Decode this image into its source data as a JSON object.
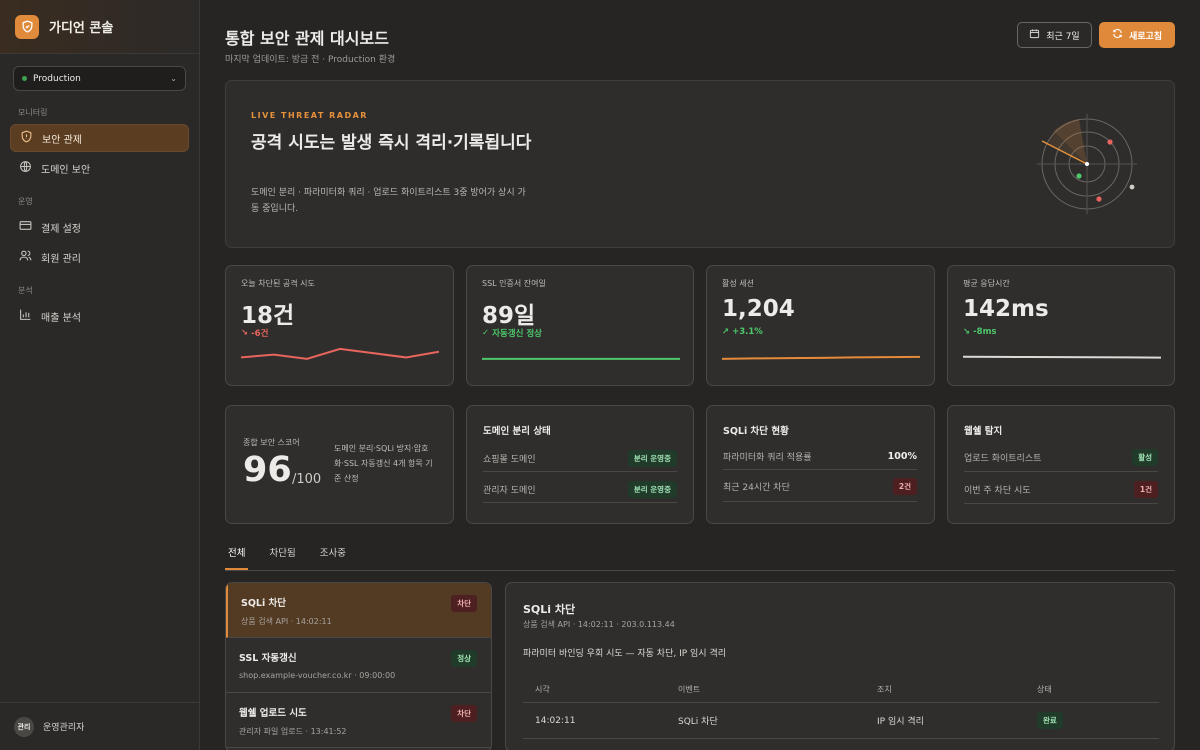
{
  "brand": {
    "name": "가디언 콘솔"
  },
  "env": {
    "label": "Production"
  },
  "sidebar": {
    "sections": [
      {
        "label": "모니터링",
        "items": [
          {
            "label": "보안 관제",
            "icon": "shield-icon"
          },
          {
            "label": "도메인 보안",
            "icon": "globe-icon"
          }
        ]
      },
      {
        "label": "운영",
        "items": [
          {
            "label": "결제 설정",
            "icon": "credit-card-icon"
          },
          {
            "label": "회원 관리",
            "icon": "users-icon"
          }
        ]
      },
      {
        "label": "분석",
        "items": [
          {
            "label": "매출 분석",
            "icon": "bar-chart-icon"
          }
        ]
      }
    ]
  },
  "user": {
    "avatar": "관리",
    "name": "운영관리자"
  },
  "header": {
    "title": "통합 보안 관제 대시보드",
    "subtitle": "마지막 업데이트: 방금 전 · Production 환경",
    "range_label": "최근 7일",
    "refresh_label": "새로고침"
  },
  "hero": {
    "tag": "LIVE THREAT RADAR",
    "heading": "공격 시도는 발생 즉시 격리·기록됩니다",
    "desc": "도메인 분리 · 파라미터화 쿼리 · 업로드 화이트리스트 3중 방어가 상시 가동 중입니다."
  },
  "kpis": [
    {
      "label": "오늘 차단된 공격 시도",
      "value": "18건",
      "delta": "-6건",
      "trend": "down",
      "color": "#e8655d",
      "spark": [
        6,
        8,
        5,
        12,
        9,
        6,
        10
      ]
    },
    {
      "label": "SSL 인증서 잔여일",
      "value": "89일",
      "delta": "자동갱신 정상",
      "trend": "ok",
      "color": "#4cc86a",
      "spark": [
        5,
        5,
        5,
        5,
        5,
        5,
        5
      ]
    },
    {
      "label": "활성 세션",
      "value": "1,204",
      "delta": "+3.1%",
      "trend": "up",
      "color": "#e58a3a",
      "spark": [
        5,
        5.3,
        5.5,
        5.7,
        6,
        6.2,
        6.4
      ]
    },
    {
      "label": "평균 응답시간",
      "value": "142ms",
      "delta": "-8ms",
      "trend": "down-good",
      "color": "#dddad4",
      "spark": [
        6.5,
        6.4,
        6.3,
        6.2,
        6.1,
        6,
        5.9
      ]
    }
  ],
  "score": {
    "label": "종합 보안 스코어",
    "value": "96",
    "max": "/100",
    "desc": "도메인 분리·SQLi 방지·암호화·SSL 자동갱신 4개 항목 기준 산정"
  },
  "status_cards": [
    {
      "title": "도메인 분리 상태",
      "rows": [
        {
          "label": "쇼핑몰 도메인",
          "badge": "분리 운영중",
          "kind": "green"
        },
        {
          "label": "관리자 도메인",
          "badge": "분리 운영중",
          "kind": "green"
        }
      ]
    },
    {
      "title": "SQLi 차단 현황",
      "rows": [
        {
          "label": "파라미터화 쿼리 적용률",
          "value": "100%"
        },
        {
          "label": "최근 24시간 차단",
          "badge": "2건",
          "kind": "red"
        }
      ]
    },
    {
      "title": "웹쉘 탐지",
      "rows": [
        {
          "label": "업로드 화이트리스트",
          "badge": "활성",
          "kind": "green"
        },
        {
          "label": "이번 주 차단 시도",
          "badge": "1건",
          "kind": "red"
        }
      ]
    }
  ],
  "tabs": [
    "전체",
    "차단됨",
    "조사중"
  ],
  "events": [
    {
      "title": "SQLi 차단",
      "sub": "상품 검색 API · 14:02:11",
      "badge": "차단",
      "kind": "red"
    },
    {
      "title": "SSL 자동갱신",
      "sub": "shop.example-voucher.co.kr · 09:00:00",
      "badge": "정상",
      "kind": "green"
    },
    {
      "title": "웹쉘 업로드 시도",
      "sub": "관리자 파일 업로드 · 13:41:52",
      "badge": "차단",
      "kind": "red"
    }
  ],
  "detail": {
    "title": "SQLi 차단",
    "sub": "상품 검색 API · 14:02:11 · 203.0.113.44",
    "desc": "파라미터 바인딩 우회 시도 — 자동 차단, IP 임시 격리",
    "columns": [
      "시각",
      "이벤트",
      "조치",
      "상태"
    ],
    "row": {
      "time": "14:02:11",
      "event": "SQLi 차단",
      "action": "IP 임시 격리",
      "status": "완료"
    }
  },
  "colors": {
    "accent": "#df8a3a",
    "danger": "#e8655d",
    "success": "#4cc86a"
  }
}
